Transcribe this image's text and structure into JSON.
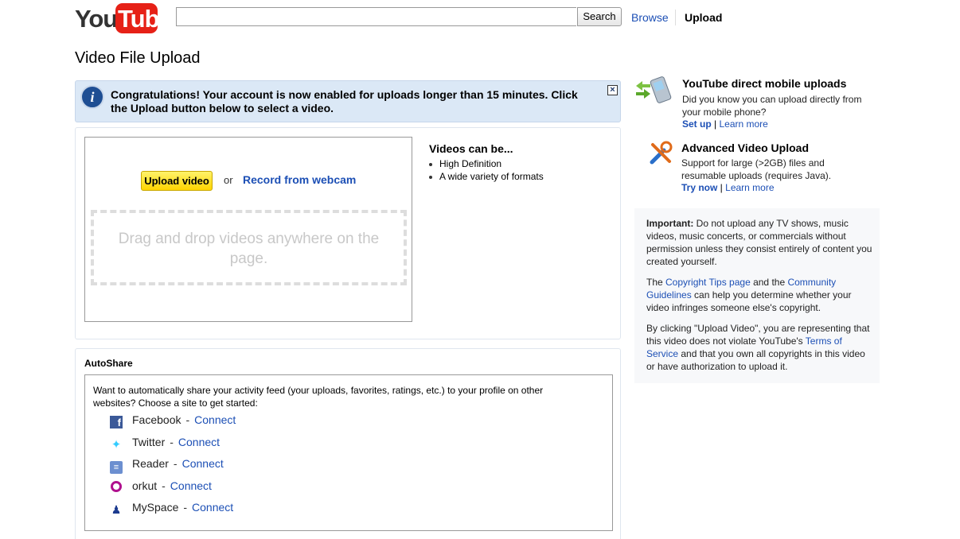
{
  "header": {
    "logo_text": "YouTube",
    "search": {
      "value": "",
      "placeholder": "",
      "button_label": "Search"
    },
    "nav": {
      "browse_label": "Browse",
      "upload_label": "Upload"
    }
  },
  "page_title": "Video File Upload",
  "notice": {
    "text": "Congratulations! Your account is now enabled for uploads longer than 15 minutes. Click the Upload button below to select a video.",
    "close_label": "×"
  },
  "upload": {
    "button_label": "Upload video",
    "or_text": "or",
    "webcam_link": "Record from webcam",
    "dropzone_text": "Drag and drop videos anywhere on the page.",
    "features_title": "Videos can be...",
    "features": [
      "High Definition",
      "A wide variety of formats"
    ]
  },
  "autoshare": {
    "title": "AutoShare",
    "description": "Want to automatically share your activity feed (your uploads, favorites, ratings, etc.) to your profile on other websites? Choose a site to get started:",
    "connect_label": "Connect",
    "sites": [
      {
        "name": "Facebook",
        "icon": "facebook-icon"
      },
      {
        "name": "Twitter",
        "icon": "twitter-icon"
      },
      {
        "name": "Reader",
        "icon": "reader-icon"
      },
      {
        "name": "orkut",
        "icon": "orkut-icon"
      },
      {
        "name": "MySpace",
        "icon": "myspace-icon"
      }
    ]
  },
  "sidebar": {
    "mobile": {
      "title": "YouTube direct mobile uploads",
      "text": "Did you know you can upload directly from your mobile phone?",
      "link1": "Set up",
      "link2": "Learn more",
      "icon": "mobile-phone-icon"
    },
    "advanced": {
      "title": "Advanced Video Upload",
      "text": "Support for large (>2GB) files and resumable uploads (requires Java).",
      "link1": "Try now",
      "link2": "Learn more",
      "icon": "tools-icon"
    },
    "important": {
      "label": "Important:",
      "text": "Do not upload any TV shows, music videos, music concerts, or commercials without permission unless they consist entirely of content you created yourself.",
      "copyright_pre": "The ",
      "copyright_link1": "Copyright Tips page",
      "copyright_mid": " and the ",
      "copyright_link2": "Community Guidelines",
      "copyright_post": " can help you determine whether your video infringes someone else's copyright.",
      "tos_pre": "By clicking \"Upload Video\", you are representing that this video does not violate YouTube's ",
      "tos_link": "Terms of Service",
      "tos_post": " and that you own all copyrights in this video or have authorization to upload it."
    }
  },
  "colors": {
    "link": "#1c4fb5",
    "logo_red": "#e62117",
    "notice_bg": "#dbe8f6",
    "upload_button": "#ffd400"
  }
}
